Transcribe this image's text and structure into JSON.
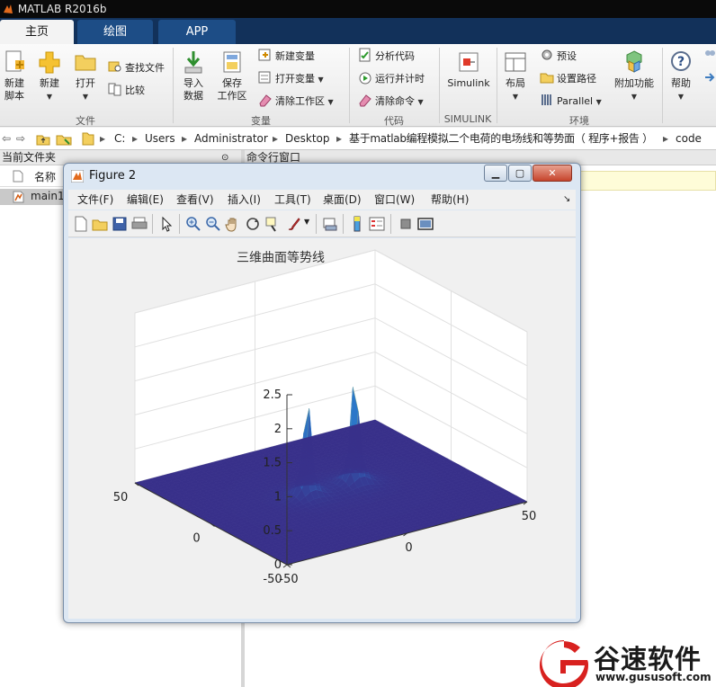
{
  "app": {
    "title": "MATLAB R2016b"
  },
  "tabs": [
    {
      "label": "主页",
      "active": true
    },
    {
      "label": "绘图",
      "active": false
    },
    {
      "label": "APP",
      "active": false
    }
  ],
  "ribbon": {
    "file": {
      "new_script": "新建\n脚本",
      "new": "新建",
      "open": "打开",
      "find_files": "查找文件",
      "compare": "比较",
      "group": "文件"
    },
    "variable": {
      "import": "导入\n数据",
      "save_ws": "保存\n工作区",
      "new_var": "新建变量",
      "open_var": "打开变量",
      "clear_ws": "清除工作区",
      "group": "变量"
    },
    "code": {
      "analyze": "分析代码",
      "run_time": "运行并计时",
      "clear_cmd": "清除命令",
      "group": "代码"
    },
    "simulink": {
      "label": "Simulink",
      "group": "SIMULINK"
    },
    "env": {
      "layout": "布局",
      "prefs": "预设",
      "set_path": "设置路径",
      "parallel": "Parallel",
      "addons": "附加功能",
      "group": "环境"
    },
    "resources": {
      "help": "帮助"
    }
  },
  "address": {
    "segments": [
      "C:",
      "Users",
      "Administrator",
      "Desktop",
      "基于matlab编程模拟二个电荷的电场线和等势面（ 程序+报告 ）",
      "code"
    ]
  },
  "panels": {
    "current_folder": "当前文件夹",
    "command_window": "命令行窗口",
    "name_header": "名称",
    "file_item": "main1"
  },
  "figure": {
    "title": "Figure 2",
    "menu": [
      "文件(F)",
      "编辑(E)",
      "查看(V)",
      "插入(I)",
      "工具(T)",
      "桌面(D)",
      "窗口(W)",
      "帮助(H)"
    ],
    "plot_title": "三维曲面等势线"
  },
  "chart_data": {
    "type": "surface",
    "title": "三维曲面等势线",
    "xlabel": "",
    "ylabel": "",
    "zlabel": "",
    "x_ticks": [
      -50,
      0,
      50
    ],
    "y_ticks": [
      -50,
      0,
      50
    ],
    "z_ticks": [
      0,
      0.5,
      1,
      1.5,
      2,
      2.5
    ],
    "xlim": [
      -50,
      50
    ],
    "ylim": [
      -50,
      50
    ],
    "zlim": [
      0,
      2.5
    ],
    "peaks": [
      {
        "x": -10,
        "y": 0,
        "z": 1.8
      },
      {
        "x": 10,
        "y": 0,
        "z": 2.0
      }
    ],
    "grid": true,
    "colormap": "parula"
  },
  "watermark": {
    "cn": "谷速软件",
    "url": "www.gususoft.com"
  },
  "colors": {
    "title_bg": "#0a0a0a",
    "tab_bar": "#12315a",
    "tab_bg": "#1d4d86",
    "surface_low": "#38308a",
    "surface_mid": "#2a7fd0",
    "surface_high": "#f2e44a",
    "watermark_red": "#d8211f"
  }
}
